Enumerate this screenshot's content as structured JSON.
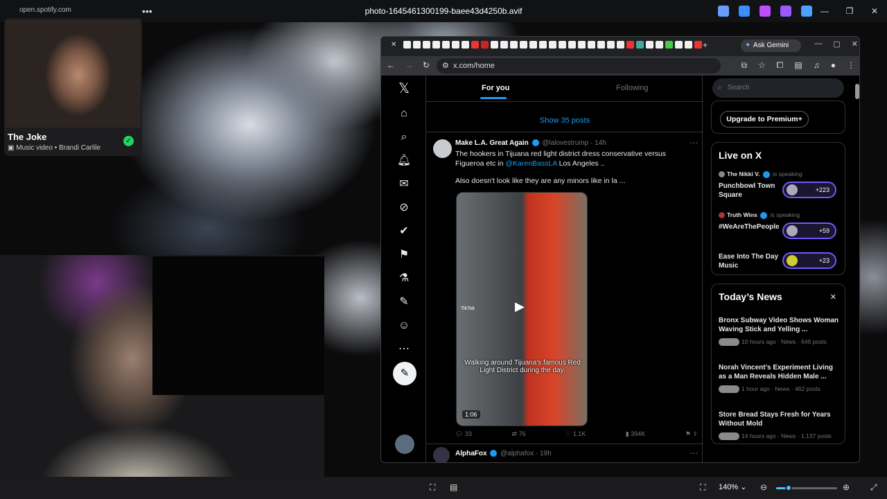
{
  "viewer": {
    "file_name": "photo-1645461300199-baee43d4250b.avif",
    "zoom": "140%",
    "zoom_level": 0.2
  },
  "spotify": {
    "url": "open.spotify.com",
    "title": "The Joke",
    "subtitle": "Music video • Brandi Carlile"
  },
  "browser": {
    "ask_gemini": "Ask Gemini",
    "url": "x.com/home"
  },
  "x": {
    "tabs": {
      "for_you": "For you",
      "following": "Following"
    },
    "show_posts": "Show 35 posts",
    "tweet": {
      "name": "Make L.A. Great Again",
      "handle": "@lalovestrump",
      "time": "· 14h",
      "text_pre": "The hookers in Tijuana red light district dress conservative versus Figueroa etc in ",
      "mention": "@KarenBassLA",
      "text_post": " Los Angeles ..",
      "text2": "Also doesn't look like they are any minors like in la ...",
      "caption": "Walking around Tijuana's famous Red Light District during the day,",
      "duration": "1:06",
      "tiktok": "TikTok",
      "replies": "33",
      "reposts": "76",
      "likes": "1.1K",
      "views": "394K"
    },
    "tweet2": {
      "name": "AlphaFox",
      "handle": "@alphafox",
      "time": "· 19h"
    },
    "search_placeholder": "Search",
    "premium": "Upgrade to Premium+",
    "live": {
      "title": "Live on X",
      "items": [
        {
          "host": "The Nikki V.",
          "status": "is speaking",
          "title": "Punchbowl Town Square",
          "count": "+223"
        },
        {
          "host": "Truth Wins",
          "status": "is speaking",
          "title": "#WeAreThePeople",
          "count": "+59"
        },
        {
          "host": "",
          "status": "",
          "title": "Ease Into The Day Music",
          "count": "+23"
        }
      ]
    },
    "news": {
      "title": "Today’s News",
      "items": [
        {
          "title": "Bronx Subway Video Shows Woman Waving Stick and Yelling ...",
          "meta": "10 hours ago · News · 649 posts"
        },
        {
          "title": "Norah Vincent's Experiment Living as a Man Reveals Hidden Male ...",
          "meta": "1 hour ago · News · 462 posts"
        },
        {
          "title": "Store Bread Stays Fresh for Years Without Mold",
          "meta": "14 hours ago · News · 1,137 posts"
        }
      ]
    }
  },
  "icons": [
    "x-logo-icon",
    "home-icon",
    "search-icon",
    "bell-icon",
    "mail-icon",
    "grok-icon",
    "verified-icon",
    "bookmark-icon",
    "flask-icon",
    "edit-icon",
    "profile-icon",
    "more-icon",
    "post-icon"
  ],
  "colors": {
    "accent": "#1d9bf0",
    "spaces": "#7856ff",
    "spotify_green": "#1ed760"
  }
}
